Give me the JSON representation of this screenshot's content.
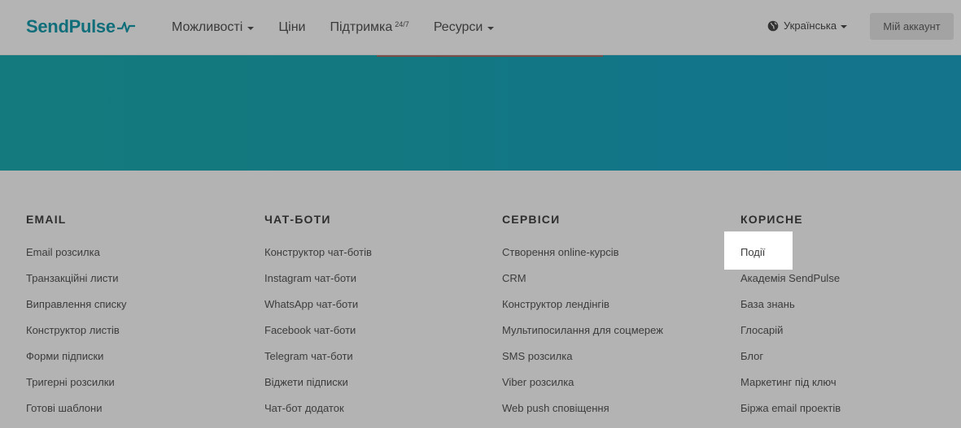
{
  "header": {
    "logo_text": "SendPulse",
    "nav": [
      {
        "label": "Можливості",
        "has_caret": true,
        "sup": ""
      },
      {
        "label": "Ціни",
        "has_caret": false,
        "sup": ""
      },
      {
        "label": "Підтримка",
        "has_caret": false,
        "sup": "24/7"
      },
      {
        "label": "Ресурси",
        "has_caret": true,
        "sup": ""
      }
    ],
    "language": "Українська",
    "account_button": "Мій аккаунт"
  },
  "footer": {
    "columns": [
      {
        "title": "EMAIL",
        "links": [
          "Email розсилка",
          "Транзакційні листи",
          "Виправлення списку",
          "Конструктор листів",
          "Форми підписки",
          "Тригерні розсилки",
          "Готові шаблони"
        ]
      },
      {
        "title": "ЧАТ-БОТИ",
        "links": [
          "Конструктор чат-ботів",
          "Instagram чат-боти",
          "WhatsApp чат-боти",
          "Facebook чат-боти",
          "Telegram чат-боти",
          "Віджети підписки",
          "Чат-бот додаток"
        ]
      },
      {
        "title": "СЕРВІСИ",
        "links": [
          "Створення online-курсів",
          "CRM",
          "Конструктор лендінгів",
          "Мультипосилання для соцмереж",
          "SMS розсилка",
          "Viber розсилка",
          "Web push сповіщення"
        ]
      },
      {
        "title": "КОРИСНЕ",
        "links": [
          "Події",
          "Академія SendPulse",
          "База знань",
          "Глосарій",
          "Блог",
          "Маркетинг під ключ",
          "Біржа email проектів"
        ]
      }
    ]
  },
  "colors": {
    "brand": "#0f6e7a",
    "hero": "#137880",
    "overlay": "#b3b3b3",
    "highlight": "#ffffff"
  }
}
